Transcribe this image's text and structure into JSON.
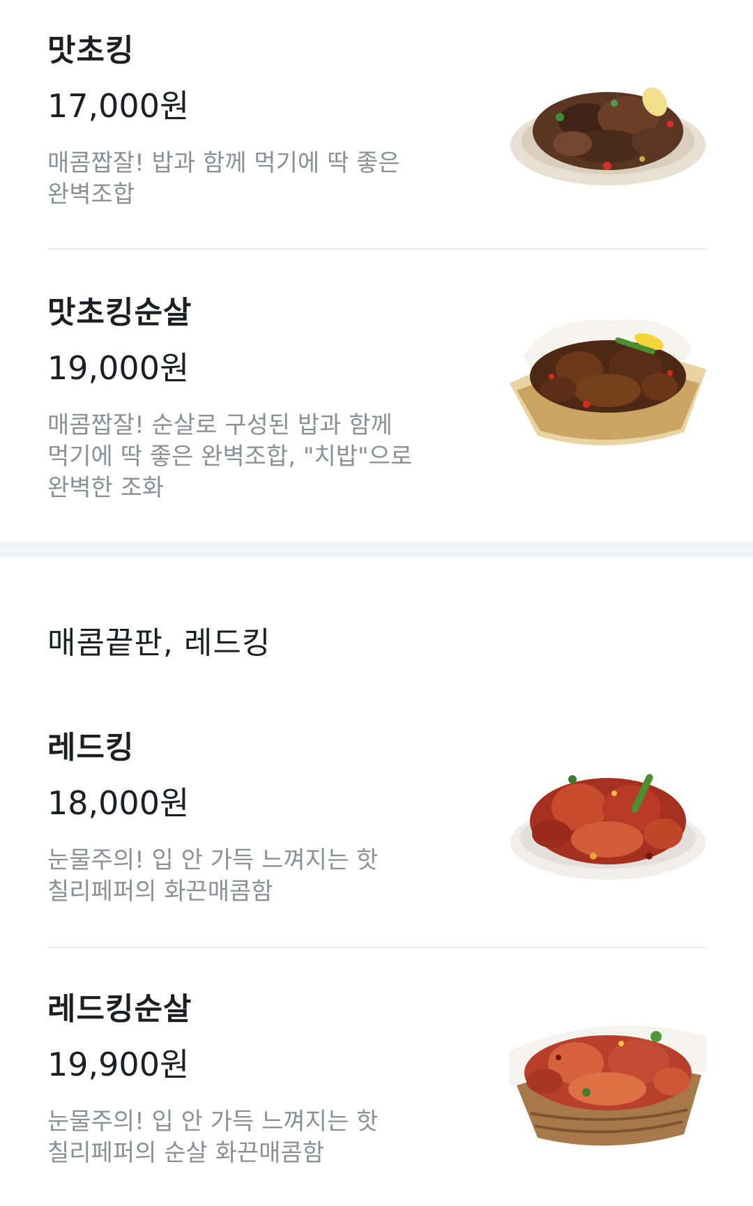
{
  "menu": {
    "items_top": [
      {
        "name": "맛초킹",
        "price": "17,000원",
        "description": "매콤짭잘! 밥과 함께 먹기에 딱 좋은 완벽조합"
      },
      {
        "name": "맛초킹순살",
        "price": "19,000원",
        "description": "매콤짭잘! 순살로 구성된 밥과 함께 먹기에 딱 좋은 완벽조합, \"치밥\"으로 완벽한 조화"
      }
    ],
    "category_red": {
      "title": "매콤끝판, 레드킹",
      "items": [
        {
          "name": "레드킹",
          "price": "18,000원",
          "description": "눈물주의! 입 안 가득 느껴지는 핫 칠리페퍼의 화끈매콤함"
        },
        {
          "name": "레드킹순살",
          "price": "19,900원",
          "description": "눈물주의! 입 안 가득 느껴지는 핫 칠리페퍼의 순살 화끈매콤함"
        }
      ]
    }
  },
  "colors": {
    "text_primary": "#1b1e22",
    "text_secondary": "#8b9096",
    "divider": "#e9ebed",
    "section_gap": "#f1f3f5"
  }
}
